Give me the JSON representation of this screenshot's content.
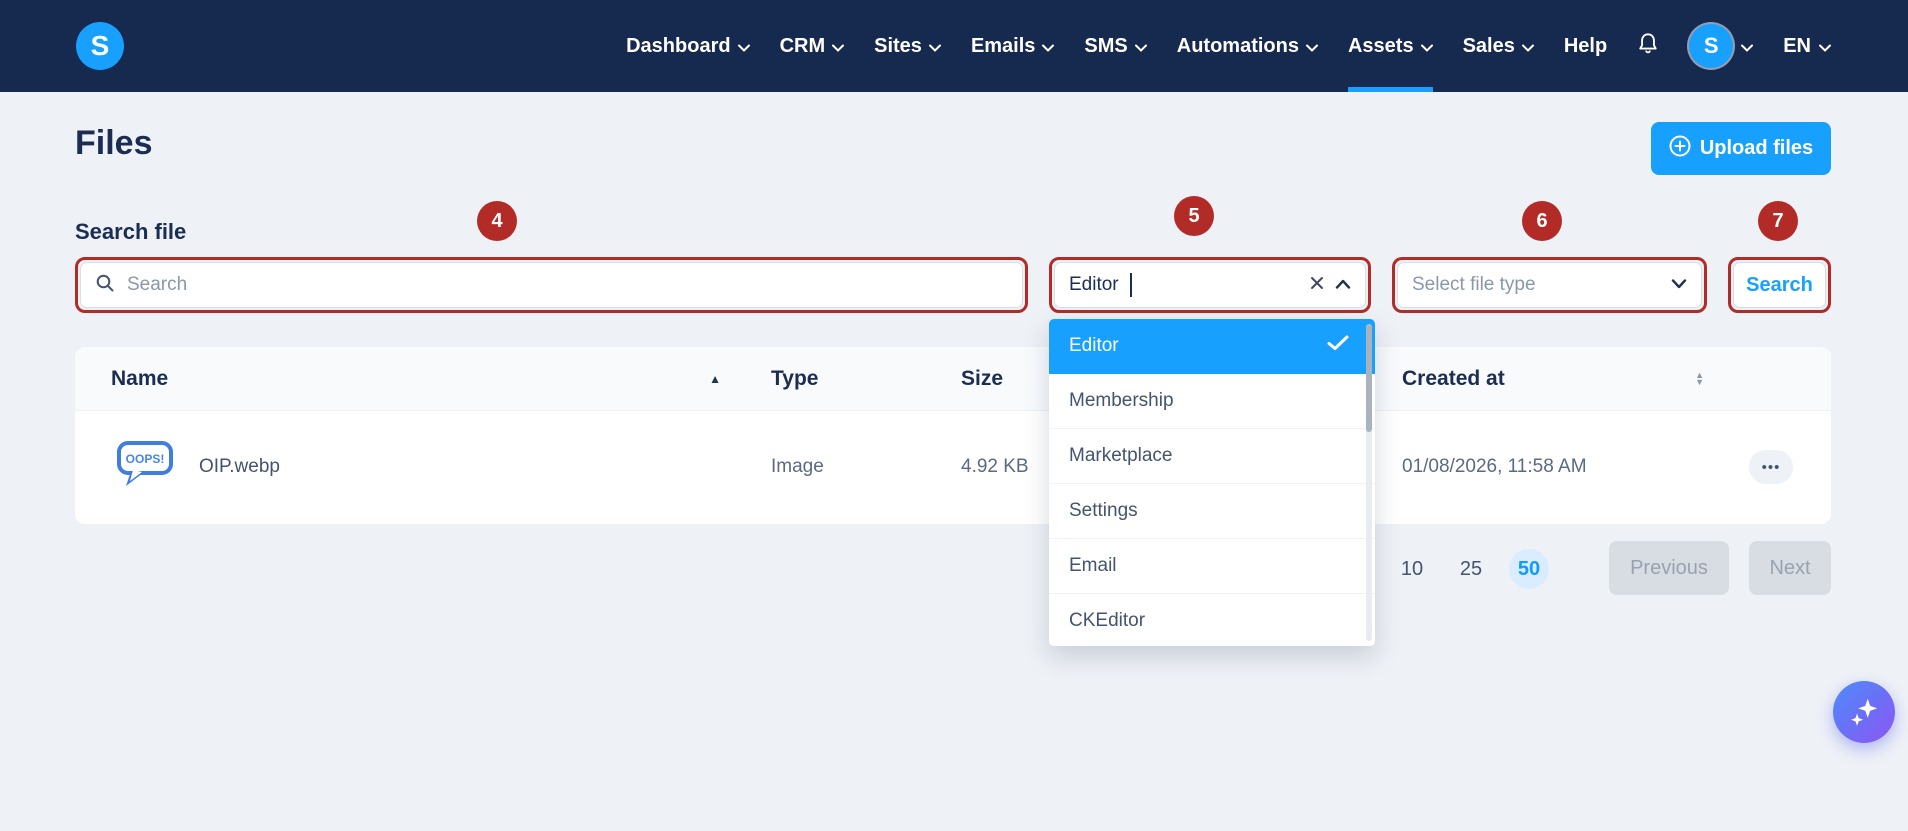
{
  "colors": {
    "accent": "#18a0ff",
    "navbar_bg": "#16294e",
    "annotation_red": "#b32b27",
    "selected_item_bg": "#18a0ff",
    "page_bg": "#eef1f6"
  },
  "navbar": {
    "logo_letter": "S",
    "items": [
      {
        "label": "Dashboard"
      },
      {
        "label": "CRM"
      },
      {
        "label": "Sites"
      },
      {
        "label": "Emails"
      },
      {
        "label": "SMS"
      },
      {
        "label": "Automations"
      },
      {
        "label": "Assets",
        "active": true
      },
      {
        "label": "Sales"
      },
      {
        "label": "Help"
      }
    ],
    "avatar_letter": "S",
    "language": "EN"
  },
  "page": {
    "title": "Files",
    "upload_button": "Upload files",
    "search_section_label": "Search file"
  },
  "filters": {
    "search_placeholder": "Search",
    "category_value": "Editor",
    "file_type_placeholder": "Select file type",
    "search_button_label": "Search"
  },
  "annotations": {
    "badges": [
      {
        "number": "4"
      },
      {
        "number": "5"
      },
      {
        "number": "6"
      },
      {
        "number": "7"
      }
    ]
  },
  "category_dropdown": {
    "items": [
      {
        "label": "Editor",
        "selected": true
      },
      {
        "label": "Membership"
      },
      {
        "label": "Marketplace"
      },
      {
        "label": "Settings"
      },
      {
        "label": "Email"
      },
      {
        "label": "CKEditor"
      }
    ]
  },
  "table": {
    "columns": [
      {
        "label": "Name",
        "sort": "asc"
      },
      {
        "label": "Type"
      },
      {
        "label": "Size"
      },
      {
        "label": "Created at",
        "sort": "both"
      }
    ],
    "rows": [
      {
        "name": "OIP.webp",
        "type": "Image",
        "size": "4.92 KB",
        "created_at": "01/08/2026, 11:58 AM",
        "thumbnail_text": "OOPS!",
        "actions": "•••"
      }
    ]
  },
  "pagination": {
    "page_sizes": [
      "10",
      "25",
      "50"
    ],
    "selected_size": "50",
    "previous_label": "Previous",
    "next_label": "Next"
  }
}
